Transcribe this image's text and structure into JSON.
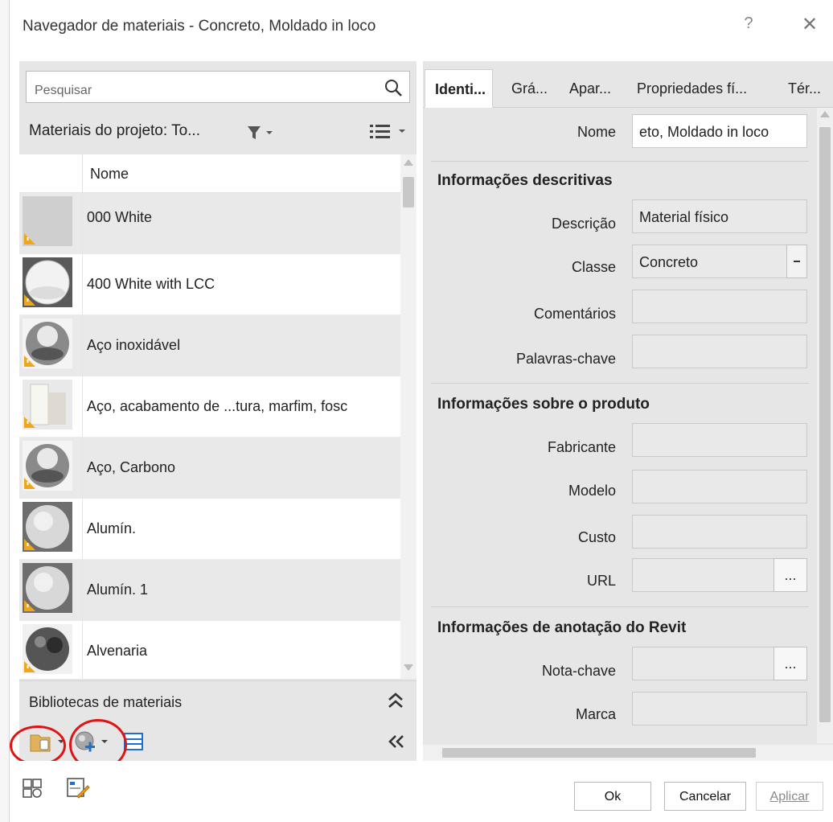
{
  "window": {
    "title": "Navegador de materiais - Concreto, Moldado in loco",
    "help_label": "?",
    "close_label": "✕"
  },
  "left": {
    "search": {
      "placeholder": "Pesquisar",
      "value": ""
    },
    "project_header": "Materiais do projeto: To...",
    "column_header": "Nome",
    "materials": [
      {
        "name": "000 White",
        "thumb": "flat-gray"
      },
      {
        "name": "400 White with LCC",
        "thumb": "white-sphere"
      },
      {
        "name": "Aço inoxidável",
        "thumb": "chrome-sphere"
      },
      {
        "name": "Aço, acabamento de ...tura, marfim, fosc",
        "thumb": "ivory-scene"
      },
      {
        "name": "Aço, Carbono",
        "thumb": "chrome-sphere"
      },
      {
        "name": "Alumín.",
        "thumb": "matte-sphere"
      },
      {
        "name": "Alumín. 1",
        "thumb": "matte-sphere"
      },
      {
        "name": "Alvenaria",
        "thumb": "dark-sphere"
      }
    ],
    "libraries_label": "Bibliotecas de materiais"
  },
  "right": {
    "tabs": [
      "Identi...",
      "Grá...",
      "Apar...",
      "Propriedades fí...",
      "Tér..."
    ],
    "name_label": "Nome",
    "name_value": "eto, Moldado in loco",
    "sections": {
      "descriptive": "Informações descritivas",
      "product": "Informações sobre o produto",
      "annotation": "Informações de anotação do Revit"
    },
    "fields": {
      "descricao": {
        "label": "Descrição",
        "value": "Material físico"
      },
      "classe": {
        "label": "Classe",
        "value": "Concreto"
      },
      "comentarios": {
        "label": "Comentários",
        "value": ""
      },
      "palavras": {
        "label": "Palavras-chave",
        "value": ""
      },
      "fabricante": {
        "label": "Fabricante",
        "value": ""
      },
      "modelo": {
        "label": "Modelo",
        "value": ""
      },
      "custo": {
        "label": "Custo",
        "value": ""
      },
      "url": {
        "label": "URL",
        "value": ""
      },
      "nota": {
        "label": "Nota-chave",
        "value": ""
      },
      "marca": {
        "label": "Marca",
        "value": ""
      }
    },
    "browse_label": "..."
  },
  "footer": {
    "ok": "Ok",
    "cancel": "Cancelar",
    "apply": "Aplicar"
  },
  "colors": {
    "highlight_ring": "#e11414",
    "panel_bg": "#e6e6e6",
    "accent_blue": "#1f6fd1",
    "warning_orange": "#f2a516"
  }
}
